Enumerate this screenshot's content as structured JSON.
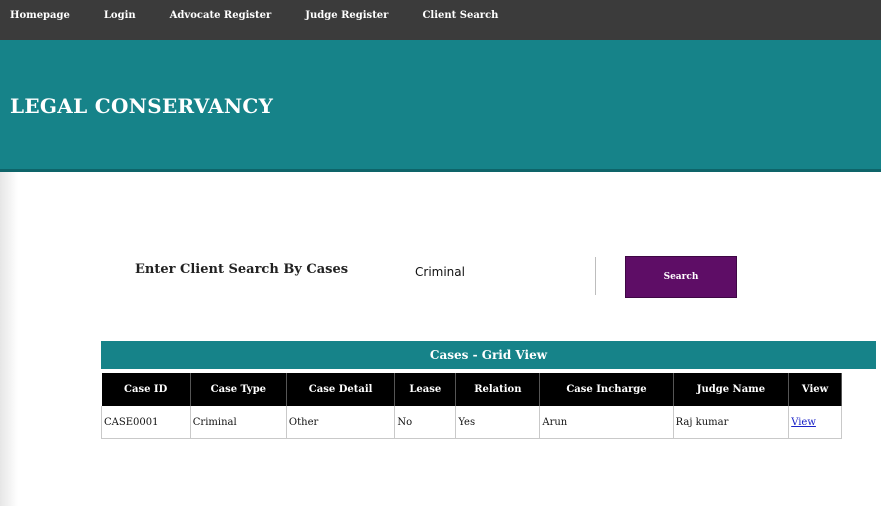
{
  "nav": {
    "items": [
      "Homepage",
      "Login",
      "Advocate Register",
      "Judge Register",
      "Client Search"
    ]
  },
  "banner": {
    "title": "LEGAL CONSERVANCY"
  },
  "search": {
    "label": "Enter Client Search By Cases",
    "value": "Criminal",
    "button_label": "Search"
  },
  "grid": {
    "title": "Cases - Grid View",
    "columns": [
      "Case ID",
      "Case Type",
      "Case Detail",
      "Lease",
      "Relation",
      "Case Incharge",
      "Judge Name",
      "View"
    ],
    "rows": [
      [
        "CASE0001",
        "Criminal",
        "Other",
        "No",
        "Yes",
        "Arun",
        "Raj kumar",
        "View"
      ]
    ]
  },
  "colors": {
    "nav_bg": "#3b3b3b",
    "banner_bg": "#168389",
    "button_bg": "#5e0d66",
    "table_header_bg": "#000000",
    "link": "#1a22c8"
  }
}
